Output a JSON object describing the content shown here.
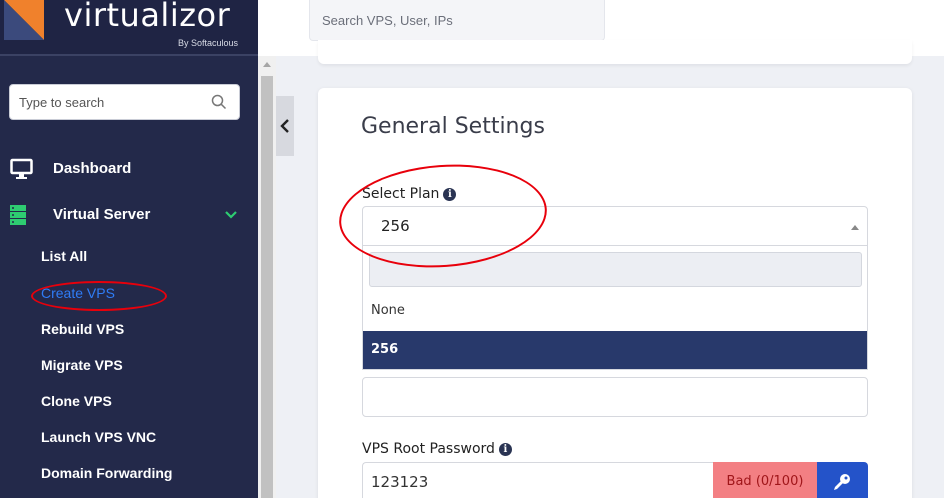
{
  "app": {
    "logo_text": "virtualizor",
    "logo_sub": "By Softaculous"
  },
  "sidebar": {
    "search_placeholder": "Type to search",
    "nav": [
      {
        "label": "Dashboard",
        "icon": "monitor-icon"
      },
      {
        "label": "Virtual Server",
        "icon": "server-icon",
        "expanded": true
      }
    ],
    "sub_items": [
      {
        "label": "List All"
      },
      {
        "label": "Create VPS",
        "active": true
      },
      {
        "label": "Rebuild VPS"
      },
      {
        "label": "Migrate VPS"
      },
      {
        "label": "Clone VPS"
      },
      {
        "label": "Launch VPS VNC"
      },
      {
        "label": "Domain Forwarding"
      }
    ]
  },
  "topbar": {
    "search_placeholder": "Search VPS, User, IPs"
  },
  "form": {
    "title": "General Settings",
    "plan_label": "Select Plan",
    "plan_value": "256",
    "plan_options": [
      "None",
      "256"
    ],
    "plan_selected": "256",
    "password_label": "VPS Root Password",
    "password_value": "123123",
    "password_strength": "Bad (0/100)"
  },
  "colors": {
    "sidebar_bg": "#23294a",
    "accent_blue": "#2f7cf6",
    "selected_option": "#28396b",
    "strength_bad": "#f37f83",
    "key_button": "#2453c9",
    "annotation": "#e8000b",
    "logo_orange": "#f0812c"
  }
}
